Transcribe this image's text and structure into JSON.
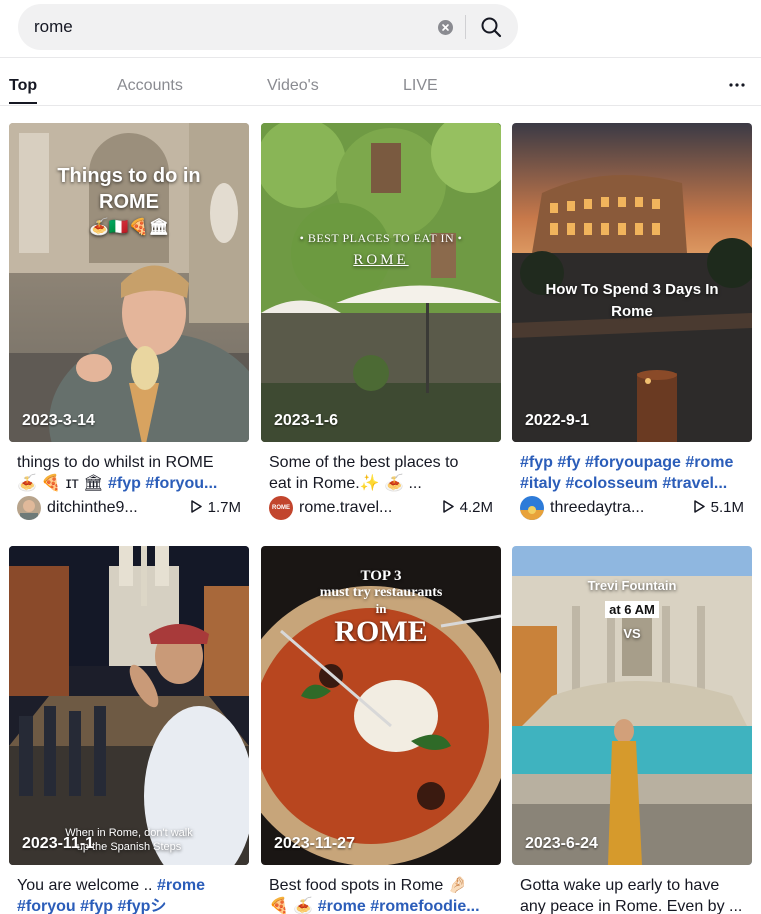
{
  "search": {
    "value": "rome",
    "placeholder": "Search"
  },
  "tabs": [
    {
      "label": "Top",
      "active": true
    },
    {
      "label": "Accounts",
      "active": false
    },
    {
      "label": "Video's",
      "active": false
    },
    {
      "label": "LIVE",
      "active": false
    }
  ],
  "accent_color": "#2b5db9",
  "cards": [
    {
      "date": "2023-3-14",
      "overlay": [
        "Things to do in",
        "ROME"
      ],
      "overlay_emoji": "🍝🇮🇹🍕🏛",
      "line1": [
        {
          "t": "things to do whilst in ROME"
        }
      ],
      "line2": [
        {
          "t": "🍝 🍕 ɪᴛ 🏛 "
        },
        {
          "t": "#fyp",
          "tag": true
        },
        {
          "t": " "
        },
        {
          "t": "#foryou...",
          "tag": true
        }
      ],
      "user": "ditchinthe9...",
      "plays": "1.7M"
    },
    {
      "date": "2023-1-6",
      "overlay": [
        "• BEST PLACES TO EAT IN •",
        "ROME"
      ],
      "line1": [
        {
          "t": "Some of the best places to"
        }
      ],
      "line2": [
        {
          "t": "eat in Rome.✨ 🍝 ..."
        }
      ],
      "user": "rome.travel...",
      "avatar_text": "ROME",
      "plays": "4.2M"
    },
    {
      "date": "2022-9-1",
      "overlay": [
        "How To Spend 3 Days In",
        "Rome"
      ],
      "line1": [
        {
          "t": "#fyp",
          "tag": true
        },
        {
          "t": " "
        },
        {
          "t": "#fy",
          "tag": true
        },
        {
          "t": " "
        },
        {
          "t": "#foryoupage",
          "tag": true
        },
        {
          "t": " "
        },
        {
          "t": "#rome",
          "tag": true
        }
      ],
      "line2": [
        {
          "t": "#italy",
          "tag": true
        },
        {
          "t": " "
        },
        {
          "t": "#colosseum",
          "tag": true
        },
        {
          "t": " "
        },
        {
          "t": "#travel...",
          "tag": true
        }
      ],
      "user": "threedaytra...",
      "plays": "5.1M"
    },
    {
      "date": "2023-11-1",
      "overlay": [
        "When in Rome, don't walk",
        "up the Spanish Steps"
      ],
      "line1": [
        {
          "t": "You are welcome .. "
        },
        {
          "t": "#rome",
          "tag": true
        }
      ],
      "line2": [
        {
          "t": "#foryou",
          "tag": true
        },
        {
          "t": " "
        },
        {
          "t": "#fyp",
          "tag": true
        },
        {
          "t": " "
        },
        {
          "t": "#fypシ",
          "tag": true
        }
      ]
    },
    {
      "date": "2023-11-27",
      "overlay": [
        "TOP 3",
        "must try restaurants",
        "in",
        "ROME"
      ],
      "line1": [
        {
          "t": "Best food spots in Rome 🤌🏻"
        }
      ],
      "line2": [
        {
          "t": "🍕 🍝 "
        },
        {
          "t": "#rome",
          "tag": true
        },
        {
          "t": " "
        },
        {
          "t": "#romefoodie...",
          "tag": true
        }
      ]
    },
    {
      "date": "2023-6-24",
      "overlay": [
        "Trevi Fountain",
        "at 6 AM",
        "VS"
      ],
      "line1": [
        {
          "t": "Gotta wake up early to have"
        }
      ],
      "line2": [
        {
          "t": "any peace in Rome. Even by ..."
        }
      ]
    }
  ]
}
